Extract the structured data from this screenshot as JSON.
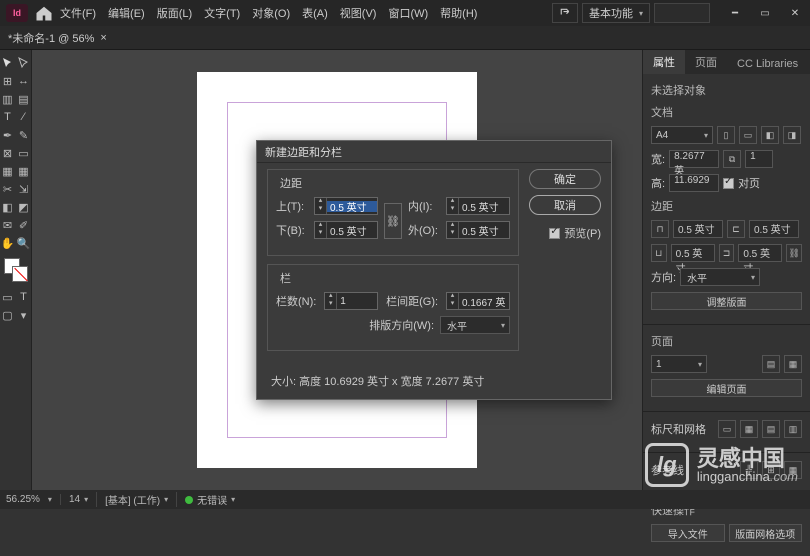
{
  "app": {
    "logo": "Id"
  },
  "menu": [
    "文件(F)",
    "编辑(E)",
    "版面(L)",
    "文字(T)",
    "对象(O)",
    "表(A)",
    "视图(V)",
    "窗口(W)",
    "帮助(H)"
  ],
  "workspace": "基本功能",
  "doc_tab": {
    "label": "*未命名-1 @ 56%"
  },
  "right_panel": {
    "tabs": [
      "属性",
      "页面",
      "CC Libraries"
    ],
    "no_selection": "未选择对象",
    "section_doc": "文档",
    "preset": "A4",
    "width_label": "宽:",
    "width": "8.2677 英",
    "height_label": "高:",
    "height": "11.6929",
    "unit": "1",
    "facing_label": "对页",
    "section_margins": "边距",
    "m_left": "0.5 英寸",
    "m_right": "0.5 英寸",
    "m_top": "0.5 英寸",
    "m_bottom": "0.5 英寸",
    "orient_label": "方向:",
    "orient_value": "水平",
    "adjust_layout_btn": "调整版面",
    "section_pages": "页面",
    "page_num": "1",
    "edit_pages_btn": "编辑页面",
    "section_ruler": "标尺和网格",
    "section_guides": "参考线",
    "section_quick": "快速操作",
    "import_btn": "导入文件",
    "grid_options_btn": "版面网格选项"
  },
  "dialog": {
    "title": "新建边距和分栏",
    "group_margins": "边距",
    "top_label": "上(T):",
    "top": "0.5 英寸",
    "bottom_label": "下(B):",
    "bottom": "0.5 英寸",
    "inside_label": "内(I):",
    "inside": "0.5 英寸",
    "outside_label": "外(O):",
    "outside": "0.5 英寸",
    "group_columns": "栏",
    "columns_label": "栏数(N):",
    "columns": "1",
    "gutter_label": "栏间距(G):",
    "gutter": "0.1667 英",
    "direction_label": "排版方向(W):",
    "direction": "水平",
    "ok": "确定",
    "cancel": "取消",
    "preview": "预览(P)",
    "size_info": "大小: 高度 10.6929 英寸 x 宽度 7.2677 英寸"
  },
  "status": {
    "zoom": "56.25%",
    "slide": "14",
    "env": "[基本] (工作)",
    "errors": "无错误"
  },
  "watermark": {
    "cn": "灵感中国",
    "en": "lingganchina",
    "suffix": ".com"
  }
}
